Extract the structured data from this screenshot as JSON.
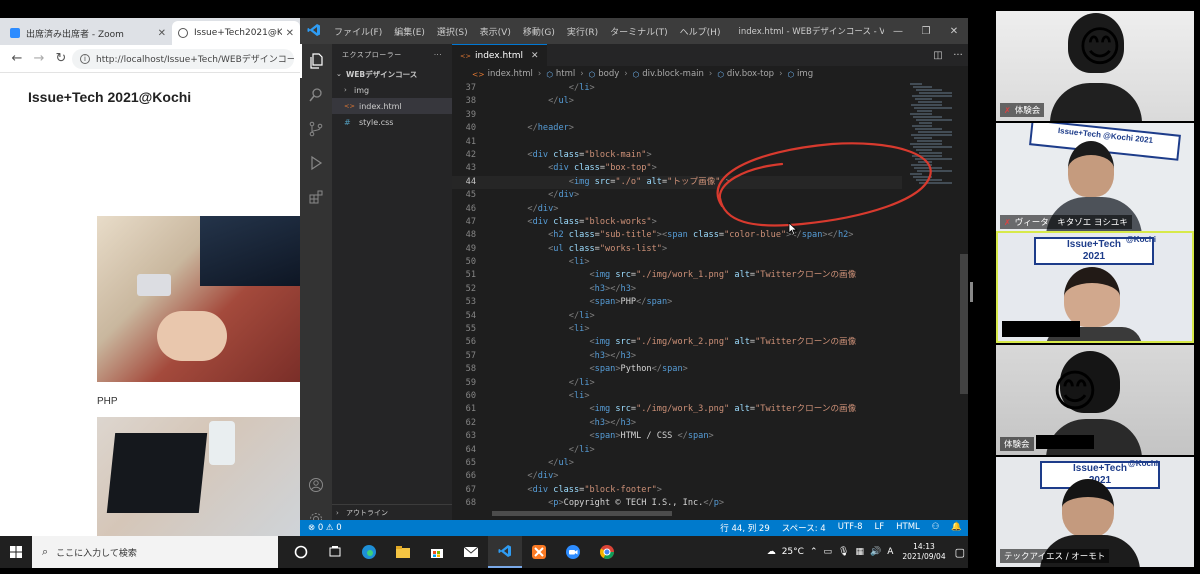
{
  "browser": {
    "tabs": [
      {
        "label": "出席済み出席者 - Zoom",
        "close": "✕"
      },
      {
        "label": "Issue+Tech2021@Kochi",
        "close": "✕"
      }
    ],
    "back": "←",
    "forward": "→",
    "reload": "↻",
    "url": "http://localhost/Issue+Tech/WEBデザインコース/",
    "page": {
      "title": "Issue+Tech 2021@Kochi",
      "work_label": "PHP"
    }
  },
  "vscode": {
    "menus": [
      "ファイル(F)",
      "編集(E)",
      "選択(S)",
      "表示(V)",
      "移動(G)",
      "実行(R)",
      "ターミナル(T)",
      "ヘルプ(H)"
    ],
    "window_title": "index.html - WEBデザインコース - Visual Studio C...",
    "window_controls": [
      "—",
      "❐",
      "✕"
    ],
    "sidebar": {
      "header": "エクスプローラー",
      "dots": "···",
      "folder": "WEBデザインコース",
      "items": [
        {
          "label": "img",
          "icon": "›",
          "type": "folder"
        },
        {
          "label": "index.html",
          "icon": "<>",
          "type": "html"
        },
        {
          "label": "style.css",
          "icon": "#",
          "type": "css"
        }
      ],
      "outline": "アウトライン"
    },
    "editor_tab": {
      "label": "index.html",
      "close": "✕"
    },
    "breadcrumb": [
      "index.html",
      "html",
      "body",
      "div.block-main",
      "div.box-top",
      "img"
    ],
    "code_lines": [
      {
        "n": "37",
        "tokens": [
          {
            "t": "                </",
            "c": "pu"
          },
          {
            "t": "li",
            "c": "tg"
          },
          {
            "t": ">",
            "c": "pu"
          }
        ]
      },
      {
        "n": "38",
        "tokens": [
          {
            "t": "            </",
            "c": "pu"
          },
          {
            "t": "ul",
            "c": "tg"
          },
          {
            "t": ">",
            "c": "pu"
          }
        ]
      },
      {
        "n": "39",
        "tokens": []
      },
      {
        "n": "40",
        "tokens": [
          {
            "t": "        </",
            "c": "pu"
          },
          {
            "t": "header",
            "c": "tg"
          },
          {
            "t": ">",
            "c": "pu"
          }
        ]
      },
      {
        "n": "41",
        "tokens": []
      },
      {
        "n": "42",
        "tokens": [
          {
            "t": "        <",
            "c": "pu"
          },
          {
            "t": "div ",
            "c": "tg"
          },
          {
            "t": "class",
            "c": "at"
          },
          {
            "t": "=",
            "c": "tx"
          },
          {
            "t": "\"block-main\"",
            "c": "st"
          },
          {
            "t": ">",
            "c": "pu"
          }
        ]
      },
      {
        "n": "43",
        "tokens": [
          {
            "t": "            <",
            "c": "pu"
          },
          {
            "t": "div ",
            "c": "tg"
          },
          {
            "t": "class",
            "c": "at"
          },
          {
            "t": "=",
            "c": "tx"
          },
          {
            "t": "\"box-top\"",
            "c": "st"
          },
          {
            "t": ">",
            "c": "pu"
          }
        ]
      },
      {
        "n": "44",
        "tokens": [
          {
            "t": "                <",
            "c": "pu"
          },
          {
            "t": "img ",
            "c": "tg"
          },
          {
            "t": "src",
            "c": "at"
          },
          {
            "t": "=",
            "c": "tx"
          },
          {
            "t": "\"./o\"",
            "c": "st"
          },
          {
            "t": " alt",
            "c": "at"
          },
          {
            "t": "=",
            "c": "tx"
          },
          {
            "t": "\"トップ画像\"",
            "c": "st"
          },
          {
            "t": " >",
            "c": "pu"
          }
        ]
      },
      {
        "n": "45",
        "tokens": [
          {
            "t": "            </",
            "c": "pu"
          },
          {
            "t": "div",
            "c": "tg"
          },
          {
            "t": ">",
            "c": "pu"
          }
        ]
      },
      {
        "n": "46",
        "tokens": [
          {
            "t": "        </",
            "c": "pu"
          },
          {
            "t": "div",
            "c": "tg"
          },
          {
            "t": ">",
            "c": "pu"
          }
        ]
      },
      {
        "n": "47",
        "tokens": [
          {
            "t": "        <",
            "c": "pu"
          },
          {
            "t": "div ",
            "c": "tg"
          },
          {
            "t": "class",
            "c": "at"
          },
          {
            "t": "=",
            "c": "tx"
          },
          {
            "t": "\"block-works\"",
            "c": "st"
          },
          {
            "t": ">",
            "c": "pu"
          }
        ]
      },
      {
        "n": "48",
        "tokens": [
          {
            "t": "            <",
            "c": "pu"
          },
          {
            "t": "h2 ",
            "c": "tg"
          },
          {
            "t": "class",
            "c": "at"
          },
          {
            "t": "=",
            "c": "tx"
          },
          {
            "t": "\"sub-title\"",
            "c": "st"
          },
          {
            "t": "><",
            "c": "pu"
          },
          {
            "t": "span ",
            "c": "tg"
          },
          {
            "t": "class",
            "c": "at"
          },
          {
            "t": "=",
            "c": "tx"
          },
          {
            "t": "\"color-blue\"",
            "c": "st"
          },
          {
            "t": "></",
            "c": "pu"
          },
          {
            "t": "span",
            "c": "tg"
          },
          {
            "t": "></",
            "c": "pu"
          },
          {
            "t": "h2",
            "c": "tg"
          },
          {
            "t": ">",
            "c": "pu"
          }
        ]
      },
      {
        "n": "49",
        "tokens": [
          {
            "t": "            <",
            "c": "pu"
          },
          {
            "t": "ul ",
            "c": "tg"
          },
          {
            "t": "class",
            "c": "at"
          },
          {
            "t": "=",
            "c": "tx"
          },
          {
            "t": "\"works-list\"",
            "c": "st"
          },
          {
            "t": ">",
            "c": "pu"
          }
        ]
      },
      {
        "n": "50",
        "tokens": [
          {
            "t": "                <",
            "c": "pu"
          },
          {
            "t": "li",
            "c": "tg"
          },
          {
            "t": ">",
            "c": "pu"
          }
        ]
      },
      {
        "n": "51",
        "tokens": [
          {
            "t": "                    <",
            "c": "pu"
          },
          {
            "t": "img ",
            "c": "tg"
          },
          {
            "t": "src",
            "c": "at"
          },
          {
            "t": "=",
            "c": "tx"
          },
          {
            "t": "\"./img/work_1.png\"",
            "c": "st"
          },
          {
            "t": " alt",
            "c": "at"
          },
          {
            "t": "=",
            "c": "tx"
          },
          {
            "t": "\"Twitterクローンの画像",
            "c": "st"
          }
        ]
      },
      {
        "n": "52",
        "tokens": [
          {
            "t": "                    <",
            "c": "pu"
          },
          {
            "t": "h3",
            "c": "tg"
          },
          {
            "t": "></",
            "c": "pu"
          },
          {
            "t": "h3",
            "c": "tg"
          },
          {
            "t": ">",
            "c": "pu"
          }
        ]
      },
      {
        "n": "53",
        "tokens": [
          {
            "t": "                    <",
            "c": "pu"
          },
          {
            "t": "span",
            "c": "tg"
          },
          {
            "t": ">",
            "c": "pu"
          },
          {
            "t": "PHP",
            "c": "tx"
          },
          {
            "t": "</",
            "c": "pu"
          },
          {
            "t": "span",
            "c": "tg"
          },
          {
            "t": ">",
            "c": "pu"
          }
        ]
      },
      {
        "n": "54",
        "tokens": [
          {
            "t": "                </",
            "c": "pu"
          },
          {
            "t": "li",
            "c": "tg"
          },
          {
            "t": ">",
            "c": "pu"
          }
        ]
      },
      {
        "n": "55",
        "tokens": [
          {
            "t": "                <",
            "c": "pu"
          },
          {
            "t": "li",
            "c": "tg"
          },
          {
            "t": ">",
            "c": "pu"
          }
        ]
      },
      {
        "n": "56",
        "tokens": [
          {
            "t": "                    <",
            "c": "pu"
          },
          {
            "t": "img ",
            "c": "tg"
          },
          {
            "t": "src",
            "c": "at"
          },
          {
            "t": "=",
            "c": "tx"
          },
          {
            "t": "\"./img/work_2.png\"",
            "c": "st"
          },
          {
            "t": " alt",
            "c": "at"
          },
          {
            "t": "=",
            "c": "tx"
          },
          {
            "t": "\"Twitterクローンの画像",
            "c": "st"
          }
        ]
      },
      {
        "n": "57",
        "tokens": [
          {
            "t": "                    <",
            "c": "pu"
          },
          {
            "t": "h3",
            "c": "tg"
          },
          {
            "t": "></",
            "c": "pu"
          },
          {
            "t": "h3",
            "c": "tg"
          },
          {
            "t": ">",
            "c": "pu"
          }
        ]
      },
      {
        "n": "58",
        "tokens": [
          {
            "t": "                    <",
            "c": "pu"
          },
          {
            "t": "span",
            "c": "tg"
          },
          {
            "t": ">",
            "c": "pu"
          },
          {
            "t": "Python",
            "c": "tx"
          },
          {
            "t": "</",
            "c": "pu"
          },
          {
            "t": "span",
            "c": "tg"
          },
          {
            "t": ">",
            "c": "pu"
          }
        ]
      },
      {
        "n": "59",
        "tokens": [
          {
            "t": "                </",
            "c": "pu"
          },
          {
            "t": "li",
            "c": "tg"
          },
          {
            "t": ">",
            "c": "pu"
          }
        ]
      },
      {
        "n": "60",
        "tokens": [
          {
            "t": "                <",
            "c": "pu"
          },
          {
            "t": "li",
            "c": "tg"
          },
          {
            "t": ">",
            "c": "pu"
          }
        ]
      },
      {
        "n": "61",
        "tokens": [
          {
            "t": "                    <",
            "c": "pu"
          },
          {
            "t": "img ",
            "c": "tg"
          },
          {
            "t": "src",
            "c": "at"
          },
          {
            "t": "=",
            "c": "tx"
          },
          {
            "t": "\"./img/work_3.png\"",
            "c": "st"
          },
          {
            "t": " alt",
            "c": "at"
          },
          {
            "t": "=",
            "c": "tx"
          },
          {
            "t": "\"Twitterクローンの画像",
            "c": "st"
          }
        ]
      },
      {
        "n": "62",
        "tokens": [
          {
            "t": "                    <",
            "c": "pu"
          },
          {
            "t": "h3",
            "c": "tg"
          },
          {
            "t": "></",
            "c": "pu"
          },
          {
            "t": "h3",
            "c": "tg"
          },
          {
            "t": ">",
            "c": "pu"
          }
        ]
      },
      {
        "n": "63",
        "tokens": [
          {
            "t": "                    <",
            "c": "pu"
          },
          {
            "t": "span",
            "c": "tg"
          },
          {
            "t": ">",
            "c": "pu"
          },
          {
            "t": "HTML / CSS ",
            "c": "tx"
          },
          {
            "t": "</",
            "c": "pu"
          },
          {
            "t": "span",
            "c": "tg"
          },
          {
            "t": ">",
            "c": "pu"
          }
        ]
      },
      {
        "n": "64",
        "tokens": [
          {
            "t": "                </",
            "c": "pu"
          },
          {
            "t": "li",
            "c": "tg"
          },
          {
            "t": ">",
            "c": "pu"
          }
        ]
      },
      {
        "n": "65",
        "tokens": [
          {
            "t": "            </",
            "c": "pu"
          },
          {
            "t": "ul",
            "c": "tg"
          },
          {
            "t": ">",
            "c": "pu"
          }
        ]
      },
      {
        "n": "66",
        "tokens": [
          {
            "t": "        </",
            "c": "pu"
          },
          {
            "t": "div",
            "c": "tg"
          },
          {
            "t": ">",
            "c": "pu"
          }
        ]
      },
      {
        "n": "67",
        "tokens": [
          {
            "t": "        <",
            "c": "pu"
          },
          {
            "t": "div ",
            "c": "tg"
          },
          {
            "t": "class",
            "c": "at"
          },
          {
            "t": "=",
            "c": "tx"
          },
          {
            "t": "\"block-footer\"",
            "c": "st"
          },
          {
            "t": ">",
            "c": "pu"
          }
        ]
      },
      {
        "n": "68",
        "tokens": [
          {
            "t": "            <",
            "c": "pu"
          },
          {
            "t": "p",
            "c": "tg"
          },
          {
            "t": ">",
            "c": "pu"
          },
          {
            "t": "Copyright © TECH I.S., Inc.",
            "c": "tx"
          },
          {
            "t": "</",
            "c": "pu"
          },
          {
            "t": "p",
            "c": "tg"
          },
          {
            "t": ">",
            "c": "pu"
          }
        ]
      }
    ],
    "current_line": "44",
    "status_left": "⊗ 0  ⚠ 0",
    "status_right": [
      "行 44, 列 29",
      "スペース: 4",
      "UTF-8",
      "LF",
      "HTML",
      "⚇",
      "🔔"
    ]
  },
  "taskbar": {
    "search_placeholder": "ここに入力して検索",
    "weather": "25°C",
    "ime": "A",
    "time": "14:13",
    "date": "2021/09/04"
  },
  "participants": [
    {
      "name": "体験会",
      "muted": true,
      "emoji": "😊"
    },
    {
      "name": "ヴィータ　キタゾエ ヨシユキ",
      "muted": true,
      "banner": "Issue+Tech @Kochi 2021"
    },
    {
      "name": "",
      "muted": false,
      "speaking": true,
      "banner_main": "Issue+Tech",
      "banner_sub": "@Kochi",
      "banner_year": "2021"
    },
    {
      "name": "体験会",
      "muted": false,
      "emoji": "😊"
    },
    {
      "name": "テックアイエス / オーモト",
      "muted": false,
      "banner_main": "Issue+Tech",
      "banner_sub": "@Kochi",
      "banner_year": "2021"
    }
  ],
  "colors": {
    "vscode_blue": "#007acc",
    "annotation_red": "#d83a2e",
    "speaker_border": "#d7e94a"
  }
}
